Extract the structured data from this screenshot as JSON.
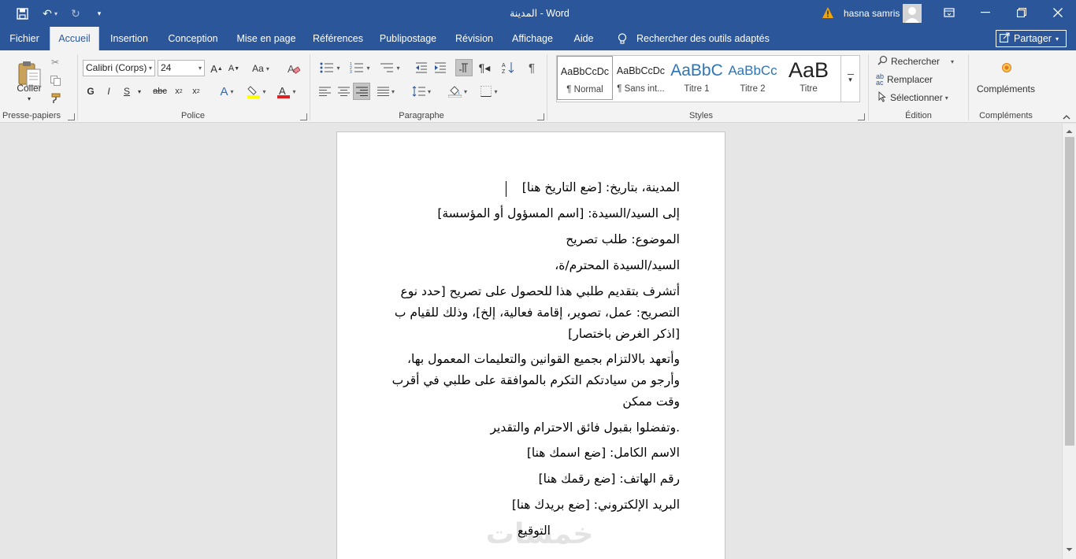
{
  "titlebar": {
    "title": "المدينة  -  Word",
    "warning_icon": "warning-icon",
    "user_name": "hasna samris",
    "accent": "#2b579a"
  },
  "tabs": [
    {
      "label": "Fichier"
    },
    {
      "label": "Accueil",
      "active": true
    },
    {
      "label": "Insertion"
    },
    {
      "label": "Conception"
    },
    {
      "label": "Mise en page"
    },
    {
      "label": "Références"
    },
    {
      "label": "Publipostage"
    },
    {
      "label": "Révision"
    },
    {
      "label": "Affichage"
    },
    {
      "label": "Aide"
    }
  ],
  "tell_me": "Rechercher des outils adaptés",
  "share_label": "Partager",
  "ribbon": {
    "clipboard": {
      "paste_label": "Coller",
      "group_label": "Presse-papiers"
    },
    "font": {
      "name": "Calibri (Corps)",
      "size": "24",
      "case_label": "Aa",
      "bold": "G",
      "italic": "I",
      "underline": "S",
      "strike": "abc",
      "group_label": "Police"
    },
    "paragraph": {
      "group_label": "Paragraphe"
    },
    "styles": {
      "items": [
        {
          "preview": "AaBbCcDc",
          "name": "¶ Normal"
        },
        {
          "preview": "AaBbCcDc",
          "name": "¶ Sans int..."
        },
        {
          "preview": "AaBbC",
          "name": "Titre 1"
        },
        {
          "preview": "AaBbCc",
          "name": "Titre 2"
        },
        {
          "preview": "AaB",
          "name": "Titre"
        }
      ],
      "group_label": "Styles"
    },
    "editing": {
      "find": "Rechercher",
      "replace": "Remplacer",
      "select": "Sélectionner",
      "group_label": "Édition"
    },
    "addins": {
      "label": "Compléments",
      "group_label": "Compléments"
    }
  },
  "document": {
    "paragraphs": [
      "المدينة، بتاريخ: [ضع التاريخ هنا]",
      "إلى السيد/السيدة: [اسم المسؤول أو المؤسسة]",
      "الموضوع: طلب تصريح",
      "السيد/السيدة المحترم/ة،",
      "أتشرف بتقديم طلبي هذا للحصول على تصريح [حدد نوع التصريح: عمل، تصوير، إقامة فعالية، إلخ]، وذلك للقيام ب [اذكر الغرض باختصار]",
      "وأتعهد بالالتزام بجميع القوانين والتعليمات المعمول بها، وأرجو من سيادتكم التكرم بالموافقة على طلبي في أقرب وقت ممكن",
      ".وتفضلوا بقبول فائق الاحترام والتقدير",
      "الاسم الكامل: [ضع اسمك هنا]",
      "رقم الهاتف: [ضع رقمك هنا]",
      "البريد الإلكتروني: [ضع بريدك هنا]",
      "التوقيع"
    ],
    "watermark": "خمسات"
  }
}
